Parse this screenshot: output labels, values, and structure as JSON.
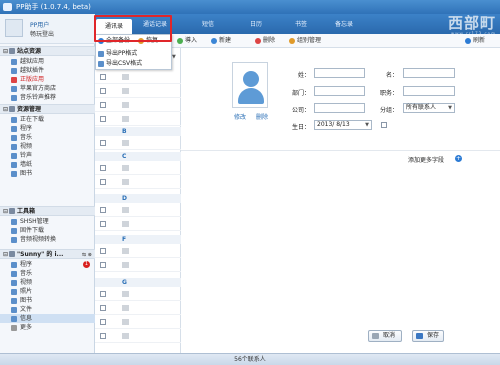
{
  "window": {
    "title": "PP助手 (1.0.7.4, beta)"
  },
  "watermark": {
    "text": "西部町",
    "sub": "www.cr173.com"
  },
  "nav": {
    "tabs": [
      "通讯录",
      "通话记录",
      "短信",
      "日历",
      "书签",
      "备忘录"
    ]
  },
  "user": {
    "name": "PP用户",
    "login": "畅玩登出"
  },
  "sidebar": {
    "sections": [
      {
        "label": "站点资源",
        "items": [
          "越狱应用",
          "越狱插件",
          "正版应用",
          "苹果官方商店",
          "音乐铃声推荐"
        ]
      },
      {
        "label": "资源管理",
        "items": [
          "正在下载",
          "程序",
          "音乐",
          "视频",
          "铃声",
          "墙纸",
          "图书"
        ]
      },
      {
        "label": "工具箱",
        "items": [
          "SHSH管理",
          "固件下载",
          "音频视频转换"
        ]
      },
      {
        "label": "\"Sunny\" 的 i...",
        "items": [
          "程序",
          "音乐",
          "视频",
          "照片",
          "图书",
          "文件",
          "信息",
          "更多"
        ]
      }
    ],
    "badge": "1",
    "device_btns": "⇆ ⊗"
  },
  "toolbar": {
    "backup": "全部备份",
    "restore": "恢复",
    "export": "導入",
    "new": "新建",
    "delete": "删除",
    "groups": "组别管理",
    "refresh": "刷新"
  },
  "dropdown": {
    "items": [
      "导出PP格式",
      "导出CSV格式"
    ]
  },
  "list": {
    "headers": [
      "B",
      "C",
      "D",
      "F",
      "G"
    ]
  },
  "detail": {
    "photo_edit": "修改",
    "photo_delete": "删除",
    "labels": {
      "surname": "姓：",
      "name": "名：",
      "dept": "部门：",
      "title": "职务：",
      "company": "公司：",
      "group": "分组：",
      "birthday": "生日："
    },
    "group_value": "所有联系人",
    "birthday_value": "2013/ 8/13",
    "add_more": "添加更多字段",
    "cancel": "取消",
    "save": "保存"
  },
  "status": {
    "text": "56个联系人"
  }
}
